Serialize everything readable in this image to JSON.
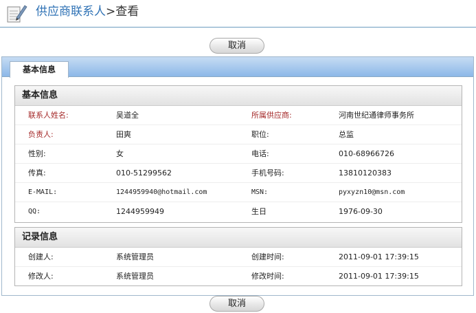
{
  "header": {
    "breadcrumb_link": "供应商联系人",
    "separator": ">",
    "breadcrumb_current": "查看"
  },
  "buttons": {
    "cancel_top": "取消",
    "cancel_bottom": "取消"
  },
  "tabs": [
    {
      "label": "基本信息",
      "active": true
    }
  ],
  "basic_section": {
    "title": "基本信息",
    "rows": [
      {
        "l1": "联系人姓名:",
        "v1": "吴道全",
        "l2": "所属供应商:",
        "v2": "河南世纪通律师事务所"
      },
      {
        "l1": "负责人:",
        "v1": "田爽",
        "l2": "职位:",
        "v2": "总监"
      },
      {
        "l1": "性别:",
        "v1": "女",
        "l2": "电话:",
        "v2": "010-68966726"
      },
      {
        "l1": "传真:",
        "v1": "010-51299562",
        "l2": "手机号码:",
        "v2": "13810120383"
      },
      {
        "l1": "E-MAIL:",
        "v1": "1244959940@hotmail.com",
        "l2": "MSN:",
        "v2": "pyxyzn10@msn.com"
      },
      {
        "l1": "QQ:",
        "v1": "1244959949",
        "l2": "生日",
        "v2": "1976-09-30"
      }
    ]
  },
  "record_section": {
    "title": "记录信息",
    "rows": [
      {
        "l1": "创建人:",
        "v1": "系统管理员",
        "l2": "创建时间:",
        "v2": "2011-09-01 17:39:15"
      },
      {
        "l1": "修改人:",
        "v1": "系统管理员",
        "l2": "修改时间:",
        "v2": "2011-09-01 17:39:15"
      }
    ]
  },
  "colors": {
    "link_blue": "#2f72b5",
    "required_label": "#a52a2a",
    "tabbar": "#8db8e8"
  },
  "icons": {
    "header": "notepad-pen-icon"
  }
}
